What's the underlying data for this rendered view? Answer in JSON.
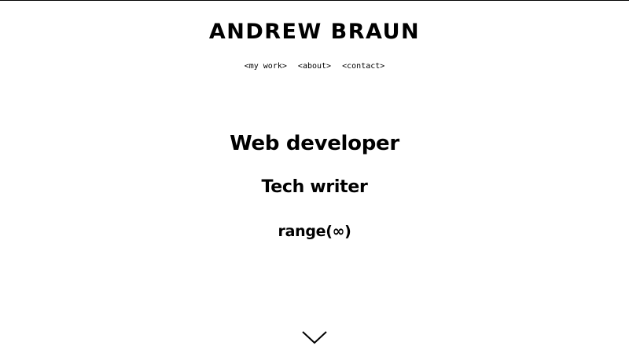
{
  "header": {
    "logo_text": "ANDREW BRAUN"
  },
  "nav": {
    "items": [
      {
        "label": "<my work>"
      },
      {
        "label": "<about>"
      },
      {
        "label": "<contact>"
      }
    ]
  },
  "hero": {
    "roles": [
      "Web developer",
      "Tech writer",
      "range(∞)"
    ]
  },
  "scroll_indicator": {
    "icon": "chevron-down-icon"
  }
}
